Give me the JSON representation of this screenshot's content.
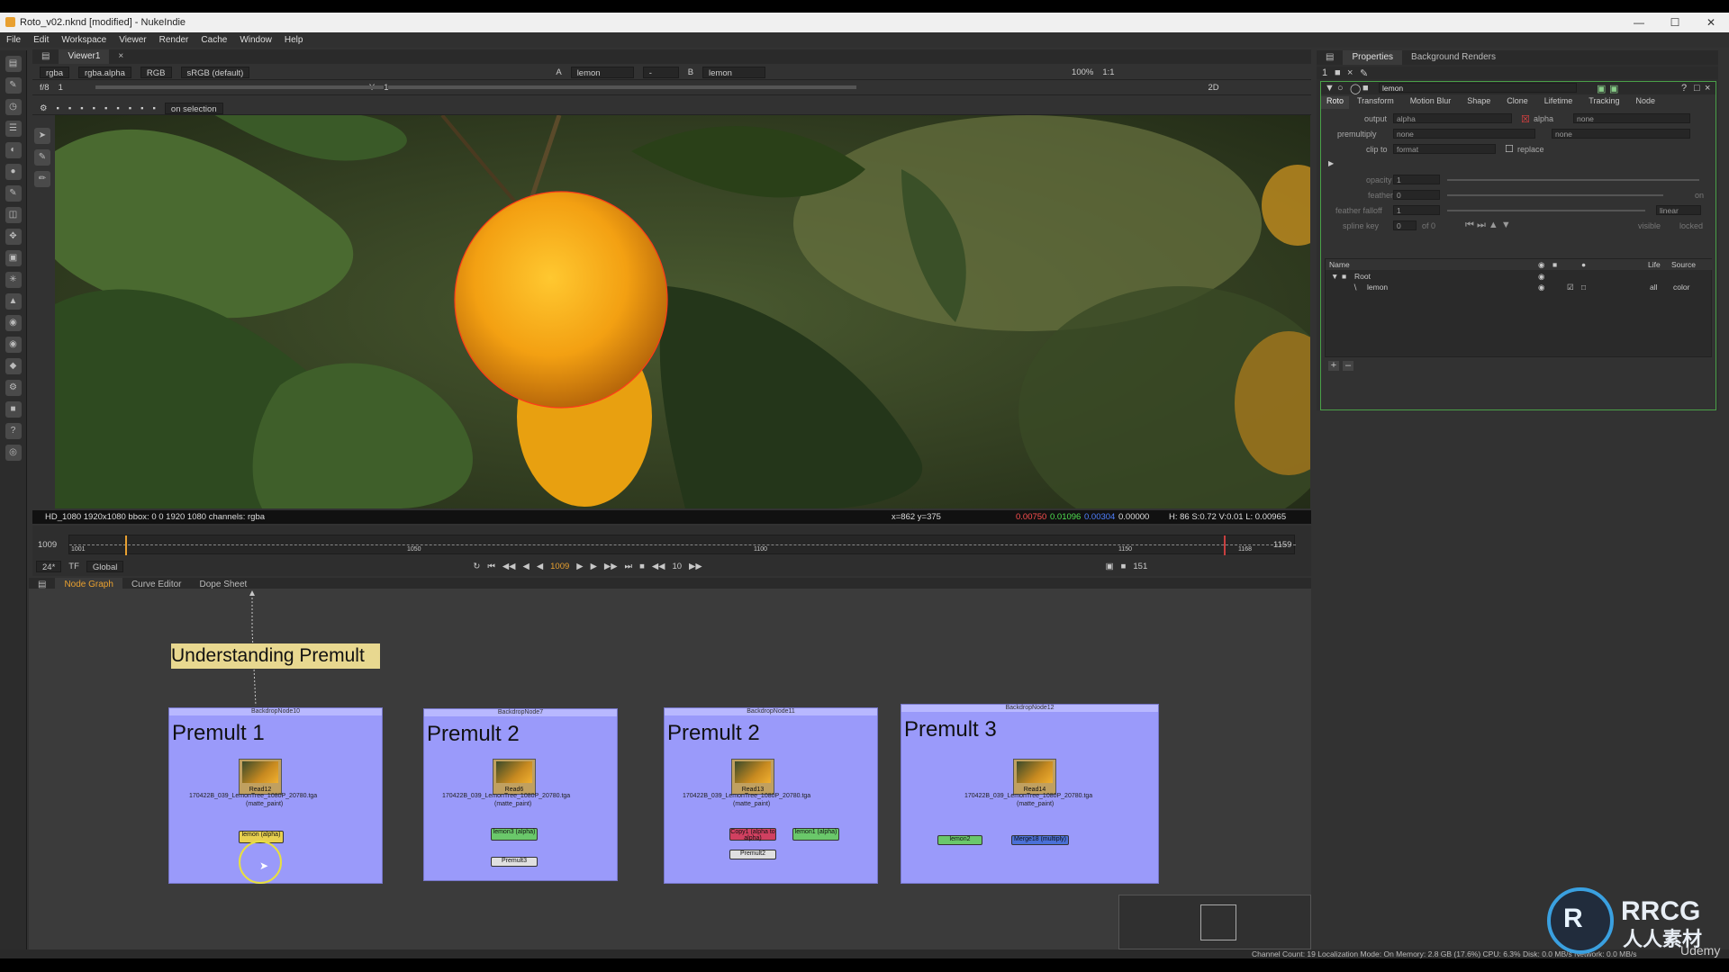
{
  "window": {
    "title": "Roto_v02.nknd [modified] - NukeIndie"
  },
  "menu": [
    "File",
    "Edit",
    "Workspace",
    "Viewer",
    "Render",
    "Cache",
    "Window",
    "Help"
  ],
  "viewer": {
    "tab": "Viewer1",
    "channels": "rgba",
    "channel_alpha": "rgba.alpha",
    "colorspace_mode": "RGB",
    "lut": "sRGB (default)",
    "input_a_label": "A",
    "input_a": "lemon",
    "input_b_label": "B",
    "input_b": "lemon",
    "zoom": "100%",
    "ratio": "1:1",
    "fstop": "f/8",
    "gain": "1",
    "gamma_label": "Y",
    "gamma": "1",
    "view_mode": "2D",
    "on_selection": "on selection",
    "info_format": "HD_1080 1920x1080  bbox: 0 0 1920 1080  channels: rgba",
    "info_coords": "x=862 y=375",
    "info_r": "0.00750",
    "info_g": "0.01096",
    "info_b": "0.00304",
    "info_a": "0.00000",
    "info_hsvl": "H: 86 S:0.72 V:0.01  L: 0.00965"
  },
  "timeline": {
    "start": "1009",
    "end": "1159",
    "tick_1001": "1001",
    "tick_1050": "1050",
    "tick_1100": "1100",
    "tick_1150": "1150",
    "tick_1168": "1168",
    "fps": "24*",
    "tf": "TF",
    "scope": "Global",
    "current_frame": "1009",
    "increment": "10",
    "count": "151"
  },
  "lower_tabs": {
    "node_graph": "Node Graph",
    "curve_editor": "Curve Editor",
    "dope_sheet": "Dope Sheet"
  },
  "nodegraph": {
    "sticky": "Understanding Premult",
    "backdrops": [
      {
        "name": "BackdropNode10",
        "label": "Premult 1",
        "read": "Read12",
        "file": "170422B_039_LemonTree_1080P_20780.tga",
        "sub": "(matte_paint)"
      },
      {
        "name": "BackdropNode7",
        "label": "Premult 2",
        "read": "Read6",
        "file": "170422B_039_LemonTree_1080P_20780.tga",
        "sub": "(matte_paint)"
      },
      {
        "name": "BackdropNode11",
        "label": "Premult 2",
        "read": "Read13",
        "file": "170422B_039_LemonTree_1080P_20780.tga",
        "sub": "(matte_paint)"
      },
      {
        "name": "BackdropNode12",
        "label": "Premult 3",
        "read": "Read14",
        "file": "170422B_039_LemonTree_1080P_20780.tga",
        "sub": "(matte_paint)"
      }
    ],
    "nodes": {
      "lemon_alpha_1": "lemon (alpha)",
      "lemon3": "lemon3 (alpha)",
      "premult3": "Premult3",
      "copy1": "Copy1 (alpha to alpha)",
      "lemon1": "lemon1 (alpha)",
      "premult2": "Premult2",
      "lemon2": "lemon2",
      "merge": "Merge18 (multiply)"
    }
  },
  "properties": {
    "tab": "Properties",
    "tab2": "Background Renders",
    "node_name": "lemon",
    "tabs": [
      "Roto",
      "Transform",
      "Motion Blur",
      "Shape",
      "Clone",
      "Lifetime",
      "Tracking",
      "Node"
    ],
    "output_label": "output",
    "output": "alpha",
    "output_alpha": "alpha",
    "output_none": "none",
    "premultiply_label": "premultiply",
    "premultiply": "none",
    "premultiply_none": "none",
    "clipto_label": "clip to",
    "clipto": "format",
    "replace": "replace",
    "opacity_label": "opacity",
    "opacity": "1",
    "feather_label": "feather",
    "feather": "0",
    "on": "on",
    "falloff_label": "feather falloff",
    "falloff": "1",
    "falloff_type": "linear",
    "splinekey_label": "spline key",
    "splinekey": "0",
    "splinekey_of": "of 0",
    "visible": "visible",
    "locked": "locked",
    "list_headers": {
      "name": "Name",
      "life": "Life",
      "source": "Source"
    },
    "tree": [
      {
        "name": "Root",
        "life": "",
        "source": ""
      },
      {
        "name": "lemon",
        "life": "all",
        "source": "color"
      }
    ]
  },
  "status": "Channel Count: 19  Localization Mode: On  Memory: 2.8 GB (17.6%)  CPU: 6.3%  Disk: 0.0 MB/s  Network: 0.0 MB/s",
  "watermark": {
    "brand": "RRCG",
    "sub": "人人素材",
    "udemy": "Udemy"
  },
  "colors": {
    "accent": "#e8a030",
    "backdrop": "#9a9afa",
    "sticky": "#e8d890",
    "roto_green": "#6ac86a",
    "copy_red": "#d04060"
  }
}
